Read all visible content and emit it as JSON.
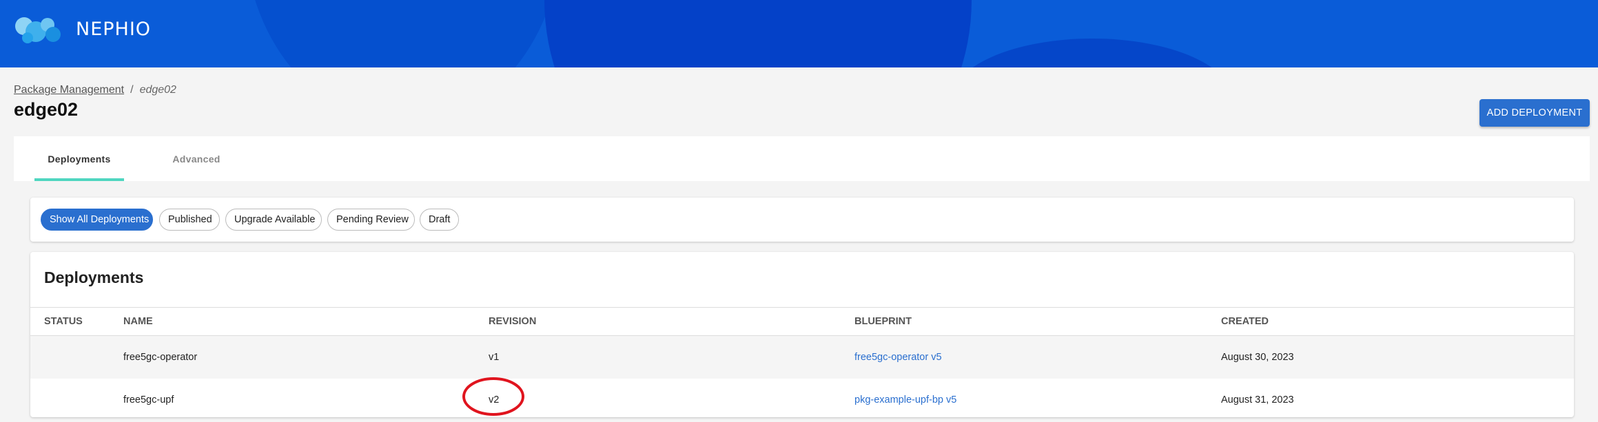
{
  "header": {
    "logo_text": "NEPHIO"
  },
  "breadcrumb": {
    "parent": "Package Management",
    "separator": "/",
    "current": "edge02"
  },
  "page": {
    "title": "edge02",
    "add_button": "ADD DEPLOYMENT"
  },
  "tabs": [
    {
      "label": "Deployments",
      "active": true
    },
    {
      "label": "Advanced",
      "active": false
    }
  ],
  "filters": [
    {
      "label": "Show All Deployments",
      "active": true
    },
    {
      "label": "Published",
      "active": false
    },
    {
      "label": "Upgrade Available",
      "active": false
    },
    {
      "label": "Pending Review",
      "active": false
    },
    {
      "label": "Draft",
      "active": false
    }
  ],
  "table": {
    "title": "Deployments",
    "columns": [
      "STATUS",
      "NAME",
      "REVISION",
      "BLUEPRINT",
      "CREATED"
    ],
    "rows": [
      {
        "status": "",
        "name": "free5gc-operator",
        "revision": "v1",
        "blueprint": "free5gc-operator v5",
        "created": "August 30, 2023"
      },
      {
        "status": "",
        "name": "free5gc-upf",
        "revision": "v2",
        "blueprint": "pkg-example-upf-bp v5",
        "created": "August 31, 2023"
      }
    ]
  },
  "colors": {
    "header_blue": "#0a5cd8",
    "accent_blue": "#2a6fcf",
    "tab_indicator": "#4fd6c0",
    "annotation_red": "#e0141e"
  },
  "icons": {
    "logo": "nephio-bubbles-logo"
  },
  "annotation": {
    "shape": "red-circle",
    "target": "table.rows.1.revision"
  }
}
